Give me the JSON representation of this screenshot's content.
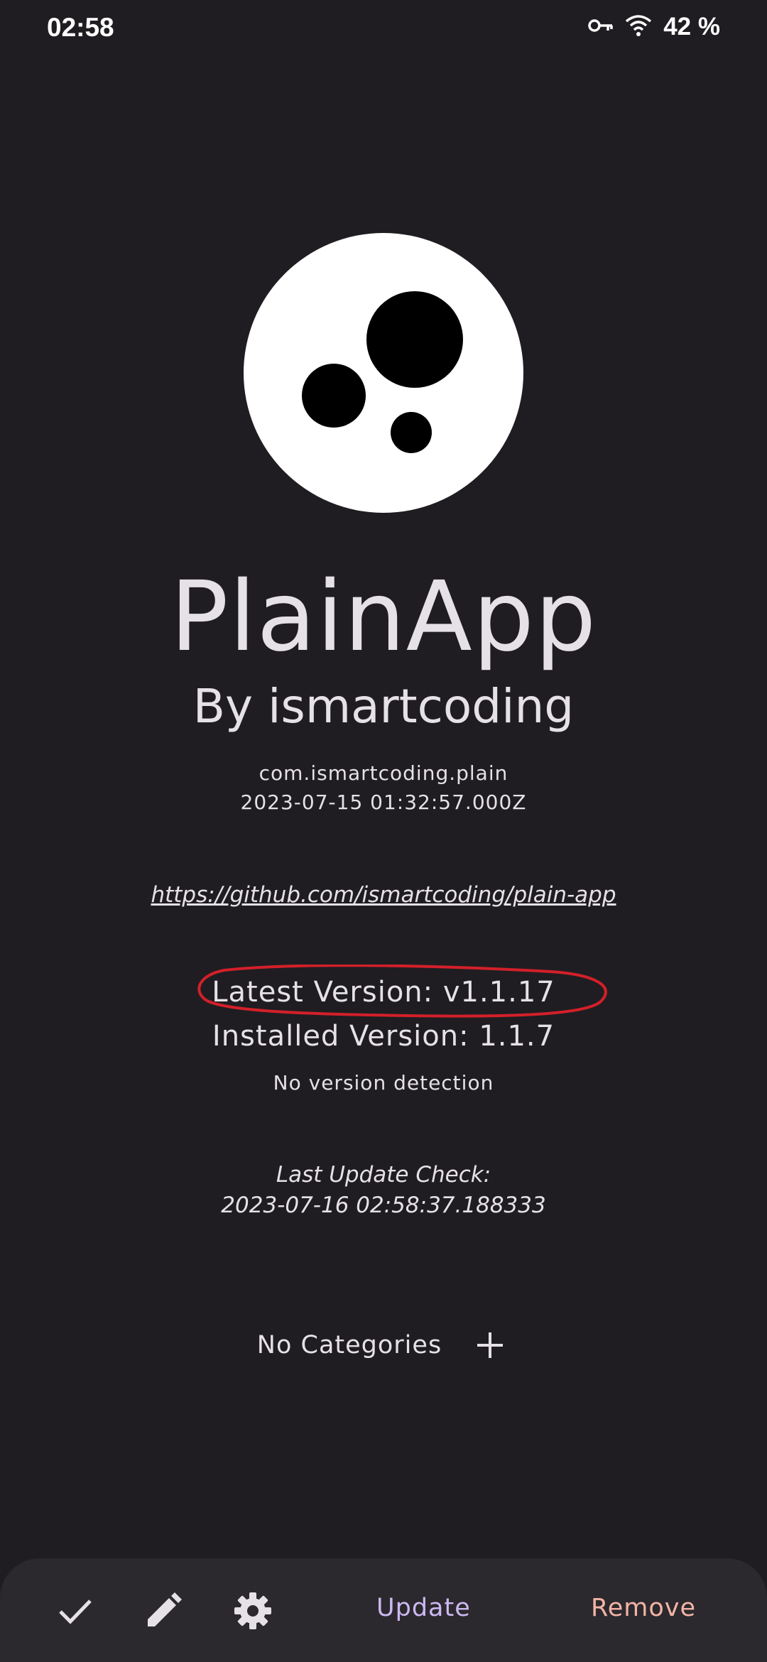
{
  "status_bar": {
    "time": "02:58",
    "battery": "42 %",
    "icons": [
      "vpn-key-icon",
      "wifi-icon"
    ]
  },
  "app": {
    "logo_icon": "plainapp-logo",
    "name": "PlainApp",
    "author": "By ismartcoding",
    "package": "com.ismartcoding.plain",
    "release_date": "2023-07-15 01:32:57.000Z",
    "repo_url": "https://github.com/ismartcoding/plain-app"
  },
  "versions": {
    "latest": "Latest Version: v1.1.17",
    "installed": "Installed Version: 1.1.7",
    "detection": "No version detection"
  },
  "last_check": {
    "label": "Last Update Check:",
    "value": "2023-07-16 02:58:37.188333"
  },
  "categories": {
    "label": "No Categories",
    "add_icon": "plus-icon"
  },
  "bottom_bar": {
    "icons": [
      "check-icon",
      "edit-icon",
      "settings-icon"
    ],
    "update_label": "Update",
    "remove_label": "Remove"
  },
  "colors": {
    "background": "#1f1d21",
    "bottom_bar": "#2b292d",
    "update": "#cdb8f2",
    "remove": "#f2b4a6",
    "annotation": "#d3202a"
  }
}
